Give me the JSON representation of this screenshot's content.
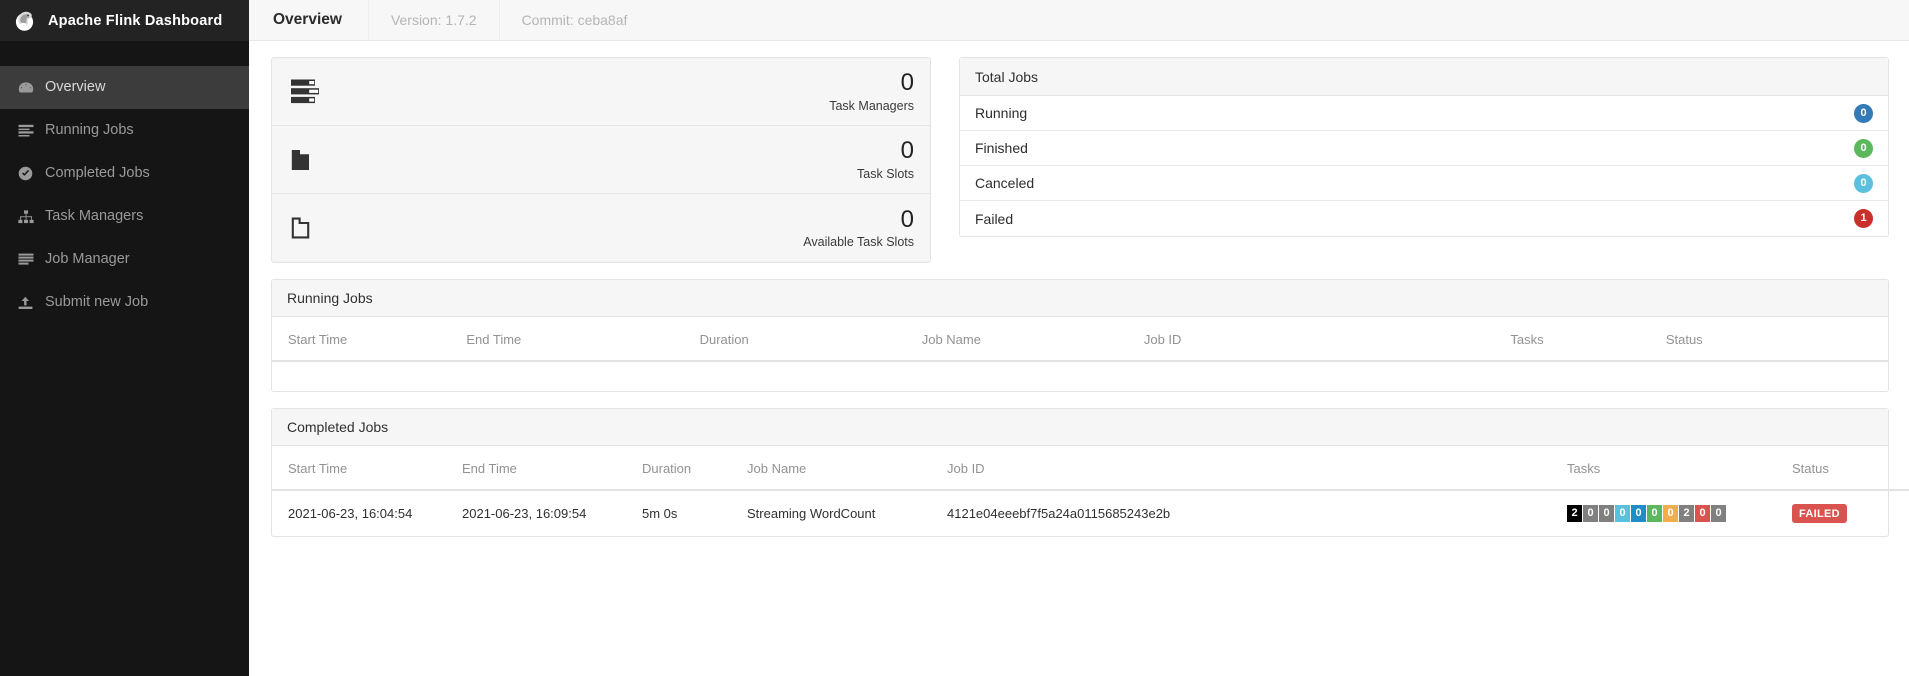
{
  "brand": {
    "title": "Apache Flink Dashboard",
    "logo_icon": "flink-squirrel-logo"
  },
  "sidebar": {
    "items": [
      {
        "label": "Overview",
        "icon": "dashboard-icon",
        "active": true
      },
      {
        "label": "Running Jobs",
        "icon": "list-icon",
        "active": false
      },
      {
        "label": "Completed Jobs",
        "icon": "check-circle-icon",
        "active": false
      },
      {
        "label": "Task Managers",
        "icon": "sitemap-icon",
        "active": false
      },
      {
        "label": "Job Manager",
        "icon": "server-icon",
        "active": false
      },
      {
        "label": "Submit new Job",
        "icon": "upload-icon",
        "active": false
      }
    ]
  },
  "topbar": {
    "tabs": [
      {
        "label": "Overview",
        "primary": true
      },
      {
        "label": "Version: 1.7.2",
        "primary": false
      },
      {
        "label": "Commit: ceba8af",
        "primary": false
      }
    ]
  },
  "stats": [
    {
      "value": "0",
      "label": "Task Managers",
      "icon": "server-rack-icon"
    },
    {
      "value": "0",
      "label": "Task Slots",
      "icon": "folder-filled-icon"
    },
    {
      "value": "0",
      "label": "Available Task Slots",
      "icon": "folder-outline-icon"
    }
  ],
  "total_jobs": {
    "title": "Total Jobs",
    "rows": [
      {
        "label": "Running",
        "count": "0",
        "color": "#337ab7"
      },
      {
        "label": "Finished",
        "count": "0",
        "color": "#5cb85c"
      },
      {
        "label": "Canceled",
        "count": "0",
        "color": "#5bc0de"
      },
      {
        "label": "Failed",
        "count": "1",
        "color": "#c9302c"
      }
    ]
  },
  "running_jobs": {
    "title": "Running Jobs",
    "columns": [
      "Start Time",
      "End Time",
      "Duration",
      "Job Name",
      "Job ID",
      "Tasks",
      "Status"
    ],
    "rows": []
  },
  "completed_jobs": {
    "title": "Completed Jobs",
    "columns": [
      "Start Time",
      "End Time",
      "Duration",
      "Job Name",
      "Job ID",
      "Tasks",
      "Status"
    ],
    "rows": [
      {
        "start_time": "2021-06-23, 16:04:54",
        "end_time": "2021-06-23, 16:09:54",
        "duration": "5m 0s",
        "job_name": "Streaming WordCount",
        "job_id": "4121e04eeebf7f5a24a0115685243e2b",
        "tasks": [
          {
            "value": "2",
            "color": "#000000"
          },
          {
            "value": "0",
            "color": "#808080"
          },
          {
            "value": "0",
            "color": "#808080"
          },
          {
            "value": "0",
            "color": "#5bc0de"
          },
          {
            "value": "0",
            "color": "#1f8ec4"
          },
          {
            "value": "0",
            "color": "#5cb85c"
          },
          {
            "value": "0",
            "color": "#f0ad4e"
          },
          {
            "value": "2",
            "color": "#808080"
          },
          {
            "value": "0",
            "color": "#d9534f"
          },
          {
            "value": "0",
            "color": "#808080"
          }
        ],
        "status": {
          "label": "FAILED",
          "color": "#d9534f"
        }
      }
    ]
  }
}
